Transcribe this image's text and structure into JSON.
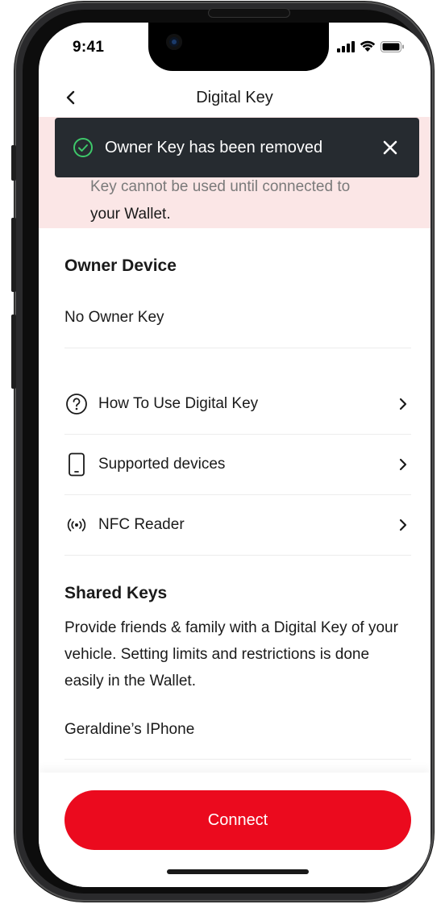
{
  "status_bar": {
    "time": "9:41"
  },
  "nav": {
    "title": "Digital Key"
  },
  "banner": {
    "line_1": "Key cannot be used until connected to",
    "line_2": "your Wallet."
  },
  "toast": {
    "message": "Owner Key has been removed"
  },
  "owner_device": {
    "title": "Owner Device",
    "value": "No Owner Key"
  },
  "menu": [
    {
      "label": "How To Use Digital Key",
      "icon": "help-circle-icon"
    },
    {
      "label": "Supported devices",
      "icon": "phone-icon"
    },
    {
      "label": "NFC Reader",
      "icon": "nfc-icon"
    }
  ],
  "shared_keys": {
    "title": "Shared Keys",
    "description": "Provide friends & family with a Digital Key of your vehicle. Setting limits and restrictions is done easily in the Wallet.",
    "devices": [
      "Geraldine’s IPhone"
    ]
  },
  "actions": {
    "connect_label": "Connect"
  },
  "colors": {
    "accent": "#eb0a1e",
    "banner_bg": "#fbe6e6",
    "toast_bg": "#262b30",
    "toast_success": "#3ec86a"
  }
}
